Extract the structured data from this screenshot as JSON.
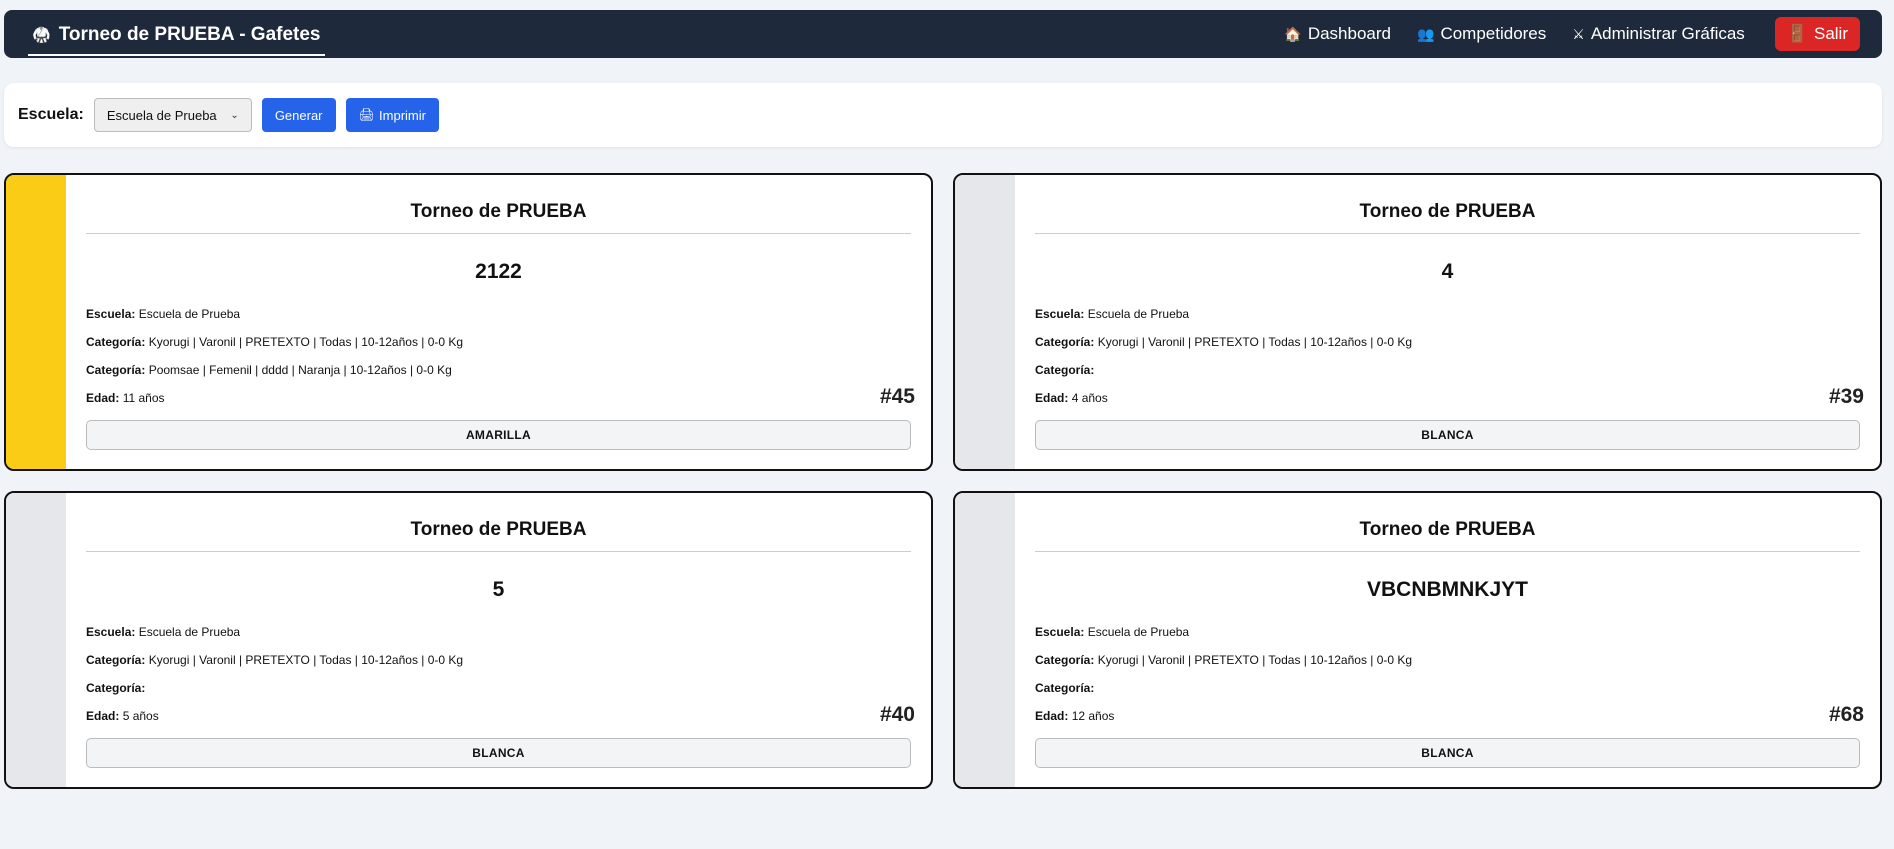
{
  "navbar": {
    "brand_icon": "🥋",
    "brand": "Torneo de PRUEBA - Gafetes",
    "links": [
      {
        "icon": "🏠",
        "label": "Dashboard"
      },
      {
        "icon": "👥",
        "label": "Competidores"
      },
      {
        "icon": "⚔",
        "label": "Administrar Gráficas"
      }
    ],
    "logout_icon": "🚪",
    "logout": "Salir"
  },
  "toolbar": {
    "school_label": "Escuela:",
    "school_selected": "Escuela de Prueba",
    "generate": "Generar",
    "print_icon": "🖨",
    "print": "Imprimir"
  },
  "labels": {
    "school": "Escuela:",
    "category": "Categoría:",
    "age": "Edad:"
  },
  "colors": {
    "yellow_belt": "#facc15",
    "white_belt": "#e5e7eb"
  },
  "cards": [
    {
      "tournament": "Torneo de PRUEBA",
      "name": "2122",
      "school": "Escuela de Prueba",
      "category1": "Kyorugi | Varonil | PRETEXTO | Todas | 10-12años | 0-0 Kg",
      "category2": "Poomsae | Femenil | dddd | Naranja | 10-12años | 0-0 Kg",
      "age": "11 años",
      "number": "#45",
      "belt": "AMARILLA",
      "stripe_color": "#facc15"
    },
    {
      "tournament": "Torneo de PRUEBA",
      "name": "4",
      "school": "Escuela de Prueba",
      "category1": "Kyorugi | Varonil | PRETEXTO | Todas | 10-12años | 0-0 Kg",
      "category2": "",
      "age": "4 años",
      "number": "#39",
      "belt": "BLANCA",
      "stripe_color": "#e5e7eb"
    },
    {
      "tournament": "Torneo de PRUEBA",
      "name": "5",
      "school": "Escuela de Prueba",
      "category1": "Kyorugi | Varonil | PRETEXTO | Todas | 10-12años | 0-0 Kg",
      "category2": "",
      "age": "5 años",
      "number": "#40",
      "belt": "BLANCA",
      "stripe_color": "#e5e7eb"
    },
    {
      "tournament": "Torneo de PRUEBA",
      "name": "VBCNBMNKJYT",
      "school": "Escuela de Prueba",
      "category1": "Kyorugi | Varonil | PRETEXTO | Todas | 10-12años | 0-0 Kg",
      "category2": "",
      "age": "12 años",
      "number": "#68",
      "belt": "BLANCA",
      "stripe_color": "#e5e7eb"
    }
  ]
}
